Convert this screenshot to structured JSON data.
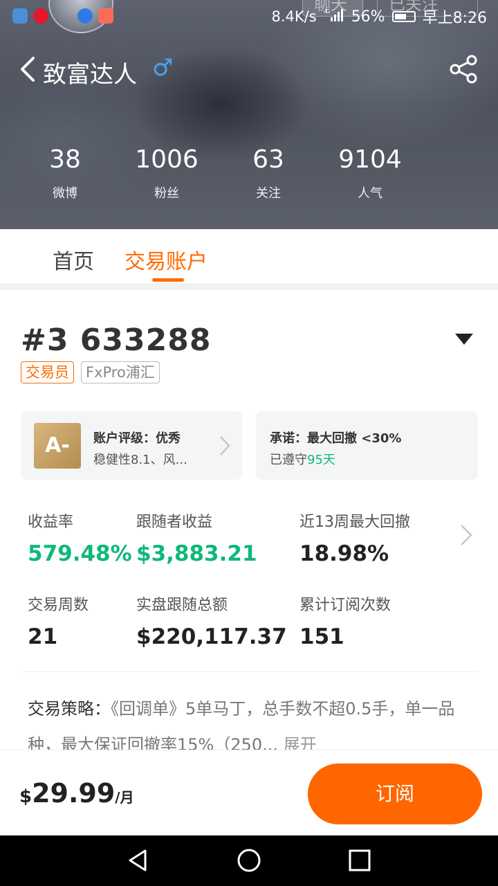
{
  "status_bar": {
    "speed": "8.4K/s",
    "network": "4G",
    "battery": "56%",
    "time": "早上8:26"
  },
  "header": {
    "ghost_chat": "聊天",
    "ghost_follow": "已关注",
    "title": "致富达人",
    "gender_symbol": "♂",
    "stats": [
      {
        "value": "38",
        "label": "微博"
      },
      {
        "value": "1006",
        "label": "粉丝"
      },
      {
        "value": "63",
        "label": "关注"
      },
      {
        "value": "9104",
        "label": "人气"
      }
    ]
  },
  "tabs": [
    {
      "label": "首页",
      "active": false
    },
    {
      "label": "交易账户",
      "active": true
    }
  ],
  "account": {
    "id": "#3 633288",
    "tags": [
      "交易员",
      "FxPro浦汇"
    ],
    "rating": {
      "grade": "A-",
      "title": "账户评级：优秀",
      "subtitle": "稳健性8.1、风..."
    },
    "promise": {
      "title": "承诺：最大回撤 <30%",
      "sub_prefix": "已遵守",
      "sub_days": "95天"
    },
    "metrics": [
      {
        "label": "收益率",
        "value": "579.48%",
        "highlight": true
      },
      {
        "label": "跟随者收益",
        "value": "$3,883.21",
        "highlight": true
      },
      {
        "label": "近13周最大回撤",
        "value": "18.98%",
        "highlight": false
      },
      {
        "label": "交易周数",
        "value": "21",
        "highlight": false
      },
      {
        "label": "实盘跟随总额",
        "value": "$220,117.37",
        "highlight": false
      },
      {
        "label": "累计订阅次数",
        "value": "151",
        "highlight": false
      }
    ],
    "strategy": {
      "label": "交易策略：",
      "text": "《回调单》5单马丁，总手数不超0.5手，单一品种，最大保证回撤率15%（250...",
      "more": "展开"
    }
  },
  "bottom": {
    "currency": "$",
    "price": "29.99",
    "unit": "/月",
    "subscribe": "订阅"
  },
  "colors": {
    "accent": "#ff6a00",
    "positive": "#0fb87a",
    "gender": "#4aa3f0"
  }
}
